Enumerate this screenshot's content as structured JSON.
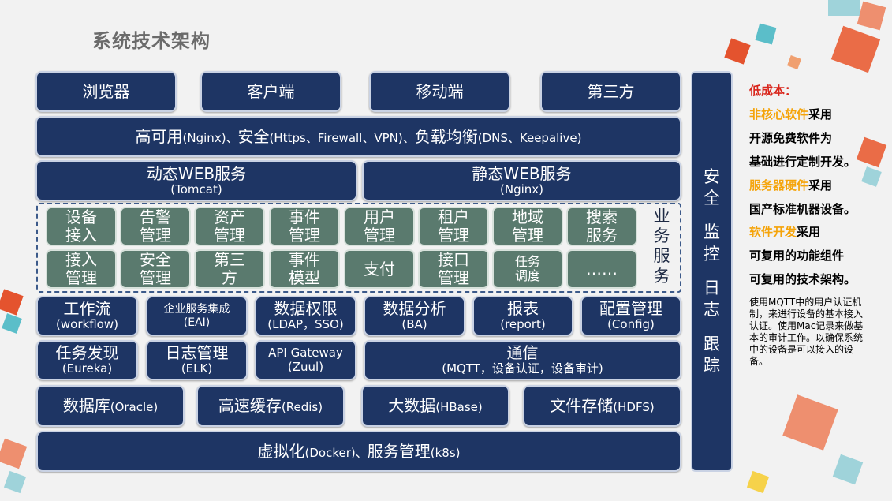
{
  "title": "系统技术架构",
  "top_row": [
    {
      "label": "浏览器"
    },
    {
      "label": "客户端"
    },
    {
      "label": "移动端"
    },
    {
      "label": "第三方"
    }
  ],
  "ha_layer": {
    "part1": "高可用",
    "part1_sub": "(Nginx)、",
    "part2": "安全",
    "part2_sub": "(Https、Firewall、VPN)、",
    "part3": "负载均衡",
    "part3_sub": "(DNS、Keepalive)"
  },
  "web": [
    {
      "main": "动态WEB服务",
      "sub": "(Tomcat)"
    },
    {
      "main": "静态WEB服务",
      "sub": "(Nginx)"
    }
  ],
  "business": {
    "label_chars": [
      "业",
      "务",
      "服",
      "务"
    ],
    "row1": [
      "设备\n接入",
      "告警\n管理",
      "资产\n管理",
      "事件\n管理",
      "用户\n管理",
      "租户\n管理",
      "地域\n管理",
      "搜索\n服务"
    ],
    "row2": [
      "接入\n管理",
      "安全\n管理",
      "第三\n方",
      "事件\n模型",
      "支付",
      "接口\n管理",
      "任务\n调度",
      "……"
    ]
  },
  "platform_row1": [
    {
      "main": "工作流",
      "sub": "(workflow)"
    },
    {
      "main": "企业服务集成",
      "sub": "(EAI)"
    },
    {
      "main": "数据权限",
      "sub": "(LDAP，SSO)"
    },
    {
      "main": "数据分析",
      "sub": "(BA)"
    },
    {
      "main": "报表",
      "sub": "(report)"
    },
    {
      "main": "配置管理",
      "sub": "(Config)"
    }
  ],
  "platform_row2": [
    {
      "main": "任务发现",
      "sub": "(Eureka)"
    },
    {
      "main": "日志管理",
      "sub": "(ELK)"
    },
    {
      "main": "API Gateway",
      "sub": "(Zuul)"
    },
    {
      "main": "通信",
      "sub": "(MQTT，设备认证，设备审计)"
    }
  ],
  "storage_row": [
    {
      "main": "数据库",
      "sub": "(Oracle)"
    },
    {
      "main": "高速缓存",
      "sub": "(Redis)"
    },
    {
      "main": "大数据",
      "sub": "(HBase)"
    },
    {
      "main": "文件存储",
      "sub": "(HDFS)"
    }
  ],
  "virtual_layer": {
    "part1": "虚拟化",
    "part1_sub": "(Docker)、",
    "part2": "服务管理",
    "part2_sub": "(k8s)"
  },
  "side_bar": [
    [
      "安",
      "全"
    ],
    [
      "监",
      "控"
    ],
    [
      "日",
      "志"
    ],
    [
      "跟",
      "踪"
    ]
  ],
  "side_text": {
    "heading": "低成本：",
    "l1_hl": "非核心软件",
    "l1": "采用",
    "l2": "开源免费软件为",
    "l3": "基础进行定制开发。",
    "l4_hl": "服务器硬件",
    "l4": "采用",
    "l5": "国产标准机器设备。",
    "l6_hl": "软件开发",
    "l6": "采用",
    "l7": "可复用的功能组件",
    "l8": "可复用的技术架构。"
  },
  "note": "使用MQTT中的用户认证机制，来进行设备的基本接入认证。使用Mac记录来做基本的审计工作。以确保系统中的设备是可以接入的设备。",
  "colors": {
    "box": "#1e3564",
    "green": "#5a7a6e",
    "red": "#d9261c",
    "orange": "#f5a40a"
  }
}
